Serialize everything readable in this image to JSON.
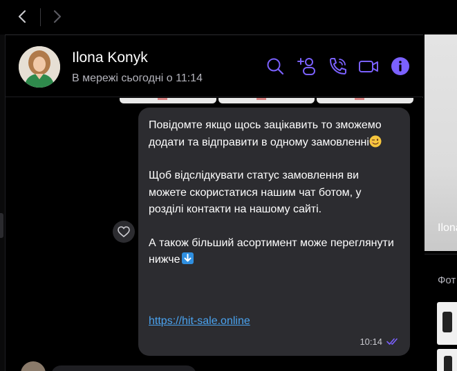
{
  "nav": {
    "back_icon": "chevron-left-icon",
    "forward_icon": "chevron-right-icon"
  },
  "chat_header": {
    "contact_name": "Ilona Konyk",
    "status": "В мережі сьогодні о 11:14",
    "icons": [
      "search-icon",
      "add-participant-icon",
      "voice-call-icon",
      "video-call-icon",
      "info-icon"
    ],
    "accent_color": "#7b61ff"
  },
  "message": {
    "paragraph_1": "Повідомте якщо щось зацікавить то зможемо додати та відправити в одному замовленні",
    "paragraph_2": "Щоб відслідкувати статус замовлення ви можете скористатися нашим чат ботом, у розділі контакти на нашому сайті.",
    "paragraph_3": "А також більший асортимент може переглянути  нижче",
    "link": "https://hit-sale.online",
    "time": "10:14",
    "emoji_1": "winking-face-emoji",
    "emoji_2": "down-arrow-emoji",
    "status_icon": "double-check-icon",
    "bubble_color": "#2c2c30",
    "link_color": "#4aa3f0"
  },
  "reaction_button_icon": "heart-icon",
  "right_panel": {
    "name": "Ilona",
    "section_label": "Фот"
  }
}
